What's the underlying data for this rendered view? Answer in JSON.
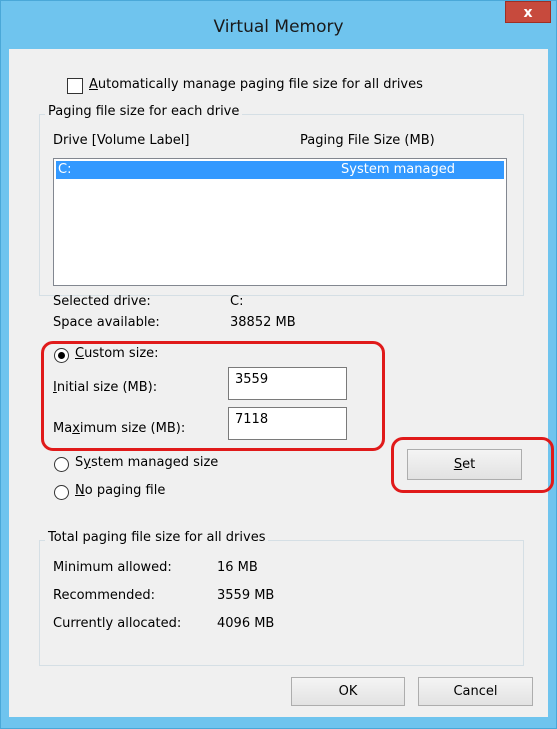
{
  "window": {
    "title": "Virtual Memory",
    "close_label": "x"
  },
  "auto_manage": {
    "label_key": "A",
    "label_rest": "utomatically manage paging file size for all drives",
    "checked": false
  },
  "drive_group": {
    "legend": "Paging file size for each drive",
    "col_drive": "Drive  [Volume Label]",
    "col_size": "Paging File Size (MB)",
    "rows": [
      {
        "drive": "C:",
        "size": "System managed",
        "selected": true
      }
    ]
  },
  "selected_drive": {
    "label": "Selected drive:",
    "value": "C:"
  },
  "space_available": {
    "label": "Space available:",
    "value": "38852 MB"
  },
  "custom_size": {
    "label_key": "C",
    "label_rest": "ustom size:",
    "selected": true
  },
  "initial_size": {
    "label_key": "I",
    "label_rest": "nitial size (MB):",
    "value": "3559"
  },
  "maximum_size": {
    "label_pre": "Ma",
    "label_key": "x",
    "label_rest": "imum size (MB):",
    "value": "7118"
  },
  "system_managed": {
    "label_pre": "S",
    "label_key": "y",
    "label_rest": "stem managed size",
    "selected": false
  },
  "no_paging": {
    "label_key": "N",
    "label_rest": "o paging file",
    "selected": false
  },
  "set_button": {
    "label_key": "S",
    "label_rest": "et"
  },
  "total_group": {
    "legend": "Total paging file size for all drives",
    "minimum_label": "Minimum allowed:",
    "minimum_value": "16 MB",
    "recommended_label": "Recommended:",
    "recommended_value": "3559 MB",
    "allocated_label": "Currently allocated:",
    "allocated_value": "4096 MB"
  },
  "ok_button": "OK",
  "cancel_button": "Cancel",
  "colors": {
    "titlebar": "#6fc4ee",
    "close": "#c74a3d",
    "selection": "#3399ff",
    "annotation": "#e01a1a"
  }
}
